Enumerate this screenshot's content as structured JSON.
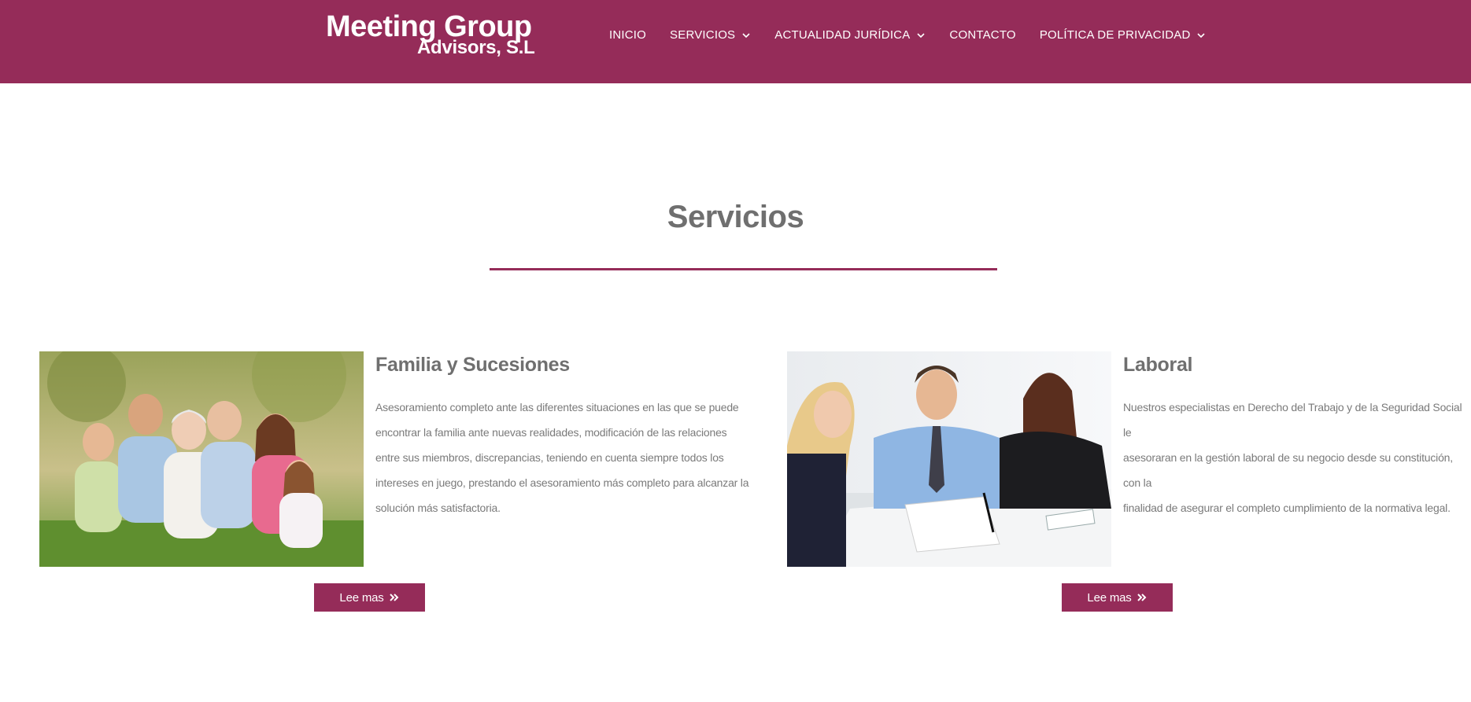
{
  "brand": {
    "line1": "Meeting Group",
    "line2": "Advisors, S.L"
  },
  "nav": {
    "items": [
      {
        "label": "INICIO"
      },
      {
        "label": "SERVICIOS"
      },
      {
        "label": "ACTUALIDAD JURÍDICA"
      },
      {
        "label": "CONTACTO"
      },
      {
        "label": "POLÍTICA DE PRIVACIDAD"
      }
    ]
  },
  "section": {
    "title": "Servicios"
  },
  "cards": [
    {
      "title": "Familia y Sucesiones",
      "text_lines": [
        "Asesoramiento completo ante las diferentes situaciones en las que se puede",
        "encontrar la familia ante nuevas realidades, modificación de las relaciones",
        "entre sus miembros, discrepancias, teniendo en cuenta siempre todos los",
        "intereses en juego, prestando el asesoramiento más completo para alcanzar la",
        "solución más satisfactoria."
      ],
      "button": "Lee mas"
    },
    {
      "title": "Laboral",
      "text_lines": [
        "Nuestros especialistas en Derecho del Trabajo y de la Seguridad Social le",
        "asesoraran en la gestión laboral de su negocio desde su constitución, con la",
        "finalidad de asegurar el completo cumplimiento de la normativa legal."
      ],
      "button": "Lee mas"
    }
  ],
  "colors": {
    "brand": "#952c59",
    "text": "#6f6f6f",
    "white": "#ffffff"
  }
}
